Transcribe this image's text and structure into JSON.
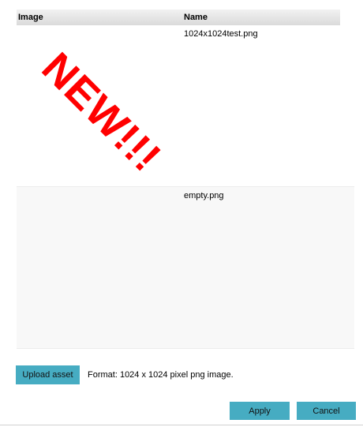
{
  "table": {
    "headers": {
      "image": "Image",
      "name": "Name"
    },
    "rows": [
      {
        "name": "1024x1024test.png",
        "thumbnail_text": "NEW!!!",
        "thumbnail_color": "#ff0000"
      },
      {
        "name": "empty.png"
      }
    ]
  },
  "upload": {
    "button_label": "Upload asset",
    "format_note": "Format: 1024 x 1024 pixel png image."
  },
  "dialog": {
    "apply_label": "Apply",
    "cancel_label": "Cancel"
  },
  "colors": {
    "button": "#46acc2",
    "header_bg": "#e6e6e6",
    "alt_row_bg": "#f8f8f8"
  }
}
